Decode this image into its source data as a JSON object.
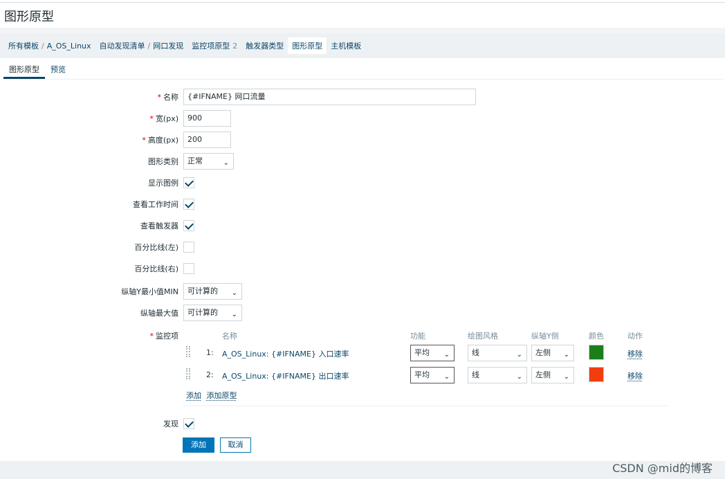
{
  "page": {
    "title": "图形原型"
  },
  "breadcrumb": {
    "items": [
      "所有模板",
      "A_OS_Linux",
      "自动发现清单",
      "网口发现",
      "监控项原型",
      "触发器类型",
      "图形原型",
      "主机模板"
    ],
    "item_prototype_count": "2"
  },
  "tabs": [
    "图形原型",
    "预览"
  ],
  "form": {
    "name": {
      "label": "名称",
      "value": "{#IFNAME} 网口流量"
    },
    "width": {
      "label": "宽(px)",
      "value": "900"
    },
    "height": {
      "label": "高度(px)",
      "value": "200"
    },
    "graph_type": {
      "label": "图形类别",
      "value": "正常"
    },
    "show_legend": {
      "label": "显示图例",
      "checked": true
    },
    "show_working_time": {
      "label": "查看工作时间",
      "checked": true
    },
    "show_triggers": {
      "label": "查看触发器",
      "checked": true
    },
    "percentile_left": {
      "label": "百分比线(左)",
      "checked": false
    },
    "percentile_right": {
      "label": "百分比线(右)",
      "checked": false
    },
    "y_min": {
      "label": "纵轴Y最小值MIN",
      "value": "可计算的"
    },
    "y_max": {
      "label": "纵轴最大值",
      "value": "可计算的"
    },
    "items": {
      "label": "监控项",
      "headers": {
        "name": "名称",
        "function": "功能",
        "draw_style": "绘图风格",
        "y_axis_side": "纵轴Y侧",
        "color": "颜色",
        "action": "动作"
      },
      "rows": [
        {
          "index": "1:",
          "name": "A_OS_Linux: {#IFNAME} 入口速率",
          "function": "平均",
          "draw_style": "线",
          "y_axis_side": "左侧",
          "color": "#1a7f1a",
          "action": "移除"
        },
        {
          "index": "2:",
          "name": "A_OS_Linux: {#IFNAME} 出口速率",
          "function": "平均",
          "draw_style": "线",
          "y_axis_side": "左侧",
          "color": "#f23d0f",
          "action": "移除"
        }
      ],
      "add_link": "添加",
      "add_prototype_link": "添加原型"
    },
    "discover": {
      "label": "发现",
      "checked": true
    }
  },
  "buttons": {
    "add": "添加",
    "cancel": "取消"
  },
  "watermark": "CSDN @mid的博客"
}
